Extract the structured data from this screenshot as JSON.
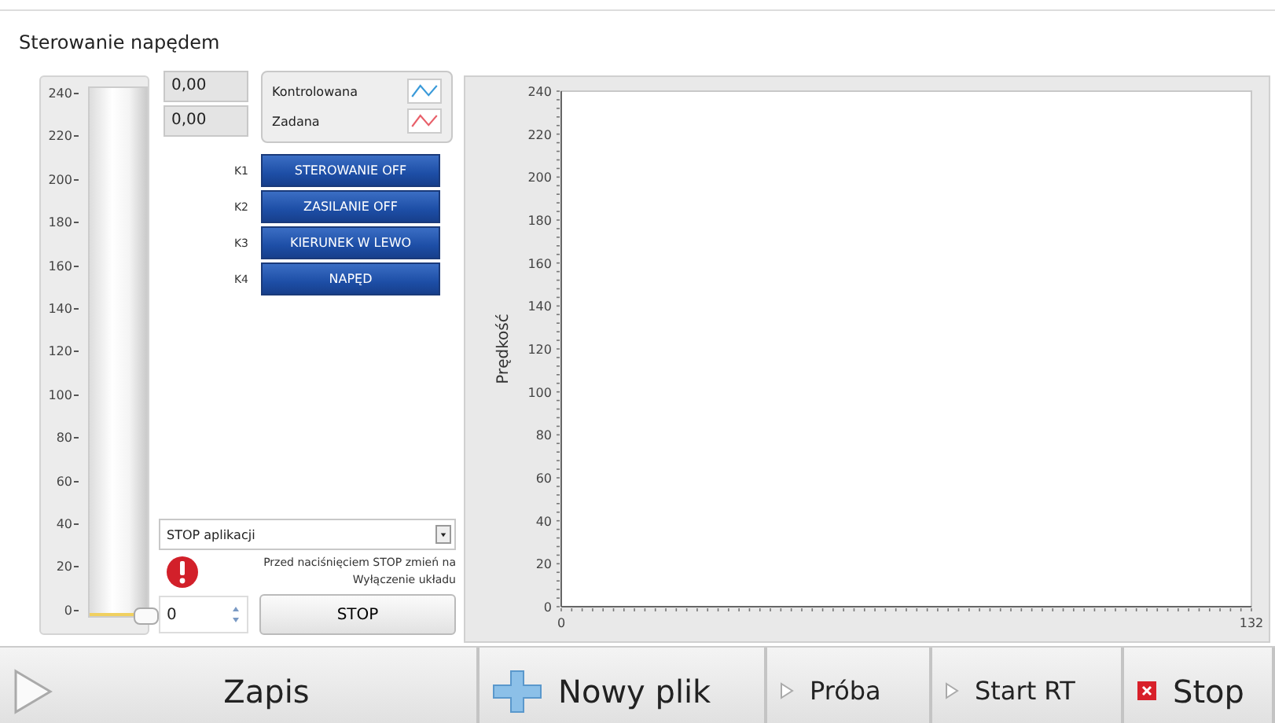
{
  "window": {
    "title": "Sterowanie napędem"
  },
  "gauge": {
    "ticks": [
      "240",
      "220",
      "200",
      "180",
      "160",
      "140",
      "120",
      "100",
      "80",
      "60",
      "40",
      "20",
      "0"
    ],
    "level": 0
  },
  "readouts": [
    "0,00",
    "0,00"
  ],
  "legend": [
    {
      "label": "Kontrolowana",
      "color": "#3a9ad9"
    },
    {
      "label": "Zadana",
      "color": "#e8606a"
    }
  ],
  "switches": [
    {
      "key": "K1",
      "label": "STEROWANIE OFF"
    },
    {
      "key": "K2",
      "label": "ZASILANIE OFF"
    },
    {
      "key": "K3",
      "label": "KIERUNEK W LEWO"
    },
    {
      "key": "K4",
      "label": "NAPĘD"
    }
  ],
  "mode_dropdown": {
    "value": "STOP aplikacji"
  },
  "warning": "Przed naciśnięciem STOP zmień na Wyłączenie układu",
  "counter": {
    "value": "0"
  },
  "stop_button": "STOP",
  "chart": {
    "chart_data": {
      "type": "line",
      "ylabel": "Prędkość",
      "xlim": [
        0,
        132
      ],
      "ylim": [
        0,
        240
      ],
      "xticks": [
        0,
        132
      ],
      "yticks": [
        0,
        20,
        40,
        60,
        80,
        100,
        120,
        140,
        160,
        180,
        200,
        220,
        240
      ]
    }
  },
  "toolbar": [
    {
      "label": "Zapis",
      "kind": "play"
    },
    {
      "label": "Nowy plik",
      "kind": "plus"
    },
    {
      "label": "Próba",
      "kind": "small-play"
    },
    {
      "label": "Start RT",
      "kind": "small-play"
    },
    {
      "label": "Stop",
      "kind": "stop"
    }
  ]
}
